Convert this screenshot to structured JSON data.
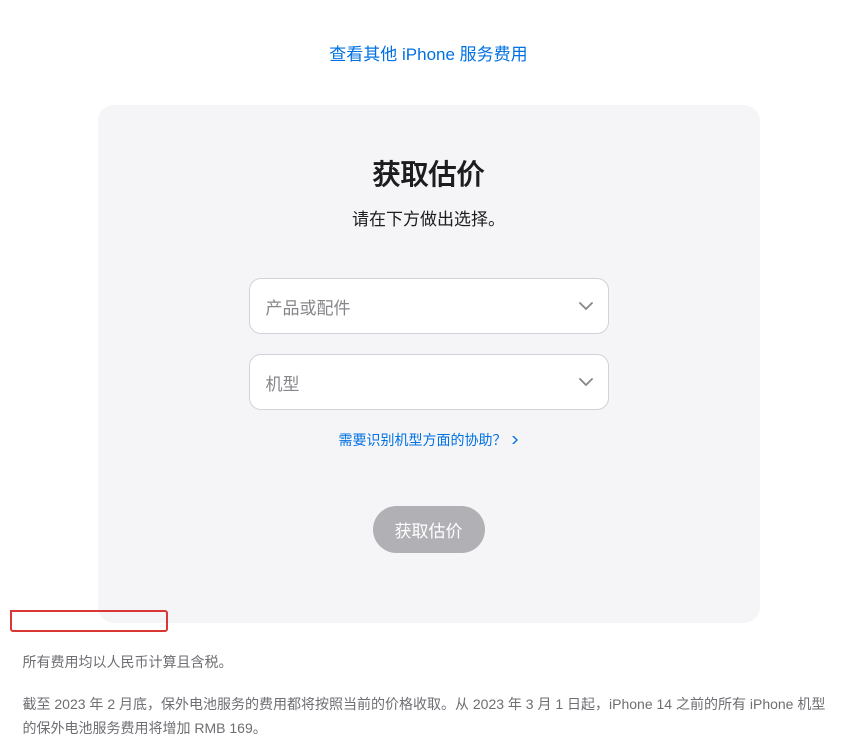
{
  "topLink": "查看其他 iPhone 服务费用",
  "card": {
    "title": "获取估价",
    "subtitle": "请在下方做出选择。",
    "selectProduct": {
      "placeholder": "产品或配件"
    },
    "selectModel": {
      "placeholder": "机型"
    },
    "helpLink": "需要识别机型方面的协助？",
    "submitButton": "获取估价"
  },
  "footnotes": {
    "line1": "所有费用均以人民币计算且含税。",
    "line2": "截至 2023 年 2 月底，保外电池服务的费用都将按照当前的价格收取。从 2023 年 3 月 1 日起，iPhone 14 之前的所有 iPhone 机型的保外电池服务费用将增加 RMB 169。"
  }
}
